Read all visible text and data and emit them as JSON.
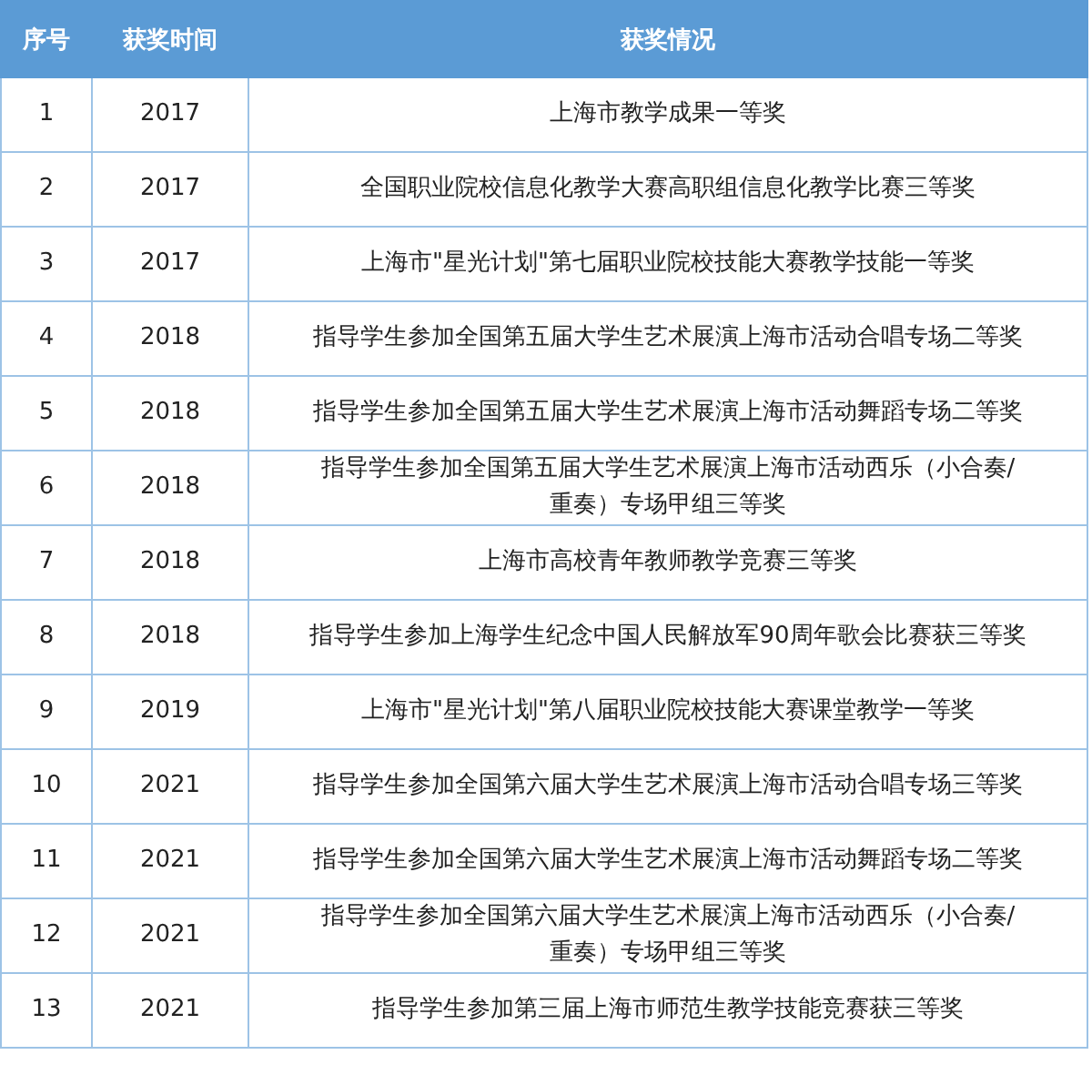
{
  "table": {
    "columns": [
      "序号",
      "获奖时间",
      "获奖情况"
    ],
    "rows": [
      {
        "cells": [
          "1",
          "2017",
          "上海市教学成果一等奖"
        ]
      },
      {
        "cells": [
          "2",
          "2017",
          "全国职业院校信息化教学大赛高职组信息化教学比赛三等奖"
        ]
      },
      {
        "cells": [
          "3",
          "2017",
          "上海市\"星光计划\"第七届职业院校技能大赛教学技能一等奖"
        ]
      },
      {
        "cells": [
          "4",
          "2018",
          "指导学生参加全国第五届大学生艺术展演上海市活动合唱专场二等奖"
        ]
      },
      {
        "cells": [
          "5",
          "2018",
          "指导学生参加全国第五届大学生艺术展演上海市活动舞蹈专场二等奖"
        ]
      },
      {
        "cells": [
          "6",
          "2018",
          "指导学生参加全国第五届大学生艺术展演上海市活动西乐（小合奏/重奏）专场甲组三等奖"
        ]
      },
      {
        "cells": [
          "7",
          "2018",
          "上海市高校青年教师教学竞赛三等奖"
        ]
      },
      {
        "cells": [
          "8",
          "2018",
          "指导学生参加上海学生纪念中国人民解放军90周年歌会比赛获三等奖"
        ]
      },
      {
        "cells": [
          "9",
          "2019",
          "上海市\"星光计划\"第八届职业院校技能大赛课堂教学一等奖"
        ]
      },
      {
        "cells": [
          "10",
          "2021",
          "指导学生参加全国第六届大学生艺术展演上海市活动合唱专场三等奖"
        ]
      },
      {
        "cells": [
          "11",
          "2021",
          "指导学生参加全国第六届大学生艺术展演上海市活动舞蹈专场二等奖"
        ]
      },
      {
        "cells": [
          "12",
          "2021",
          "指导学生参加全国第六届大学生艺术展演上海市活动西乐（小合奏/重奏）专场甲组三等奖"
        ]
      },
      {
        "cells": [
          "13",
          "2021",
          "指导学生参加第三届上海市师范生教学技能竞赛获三等奖"
        ]
      }
    ]
  }
}
